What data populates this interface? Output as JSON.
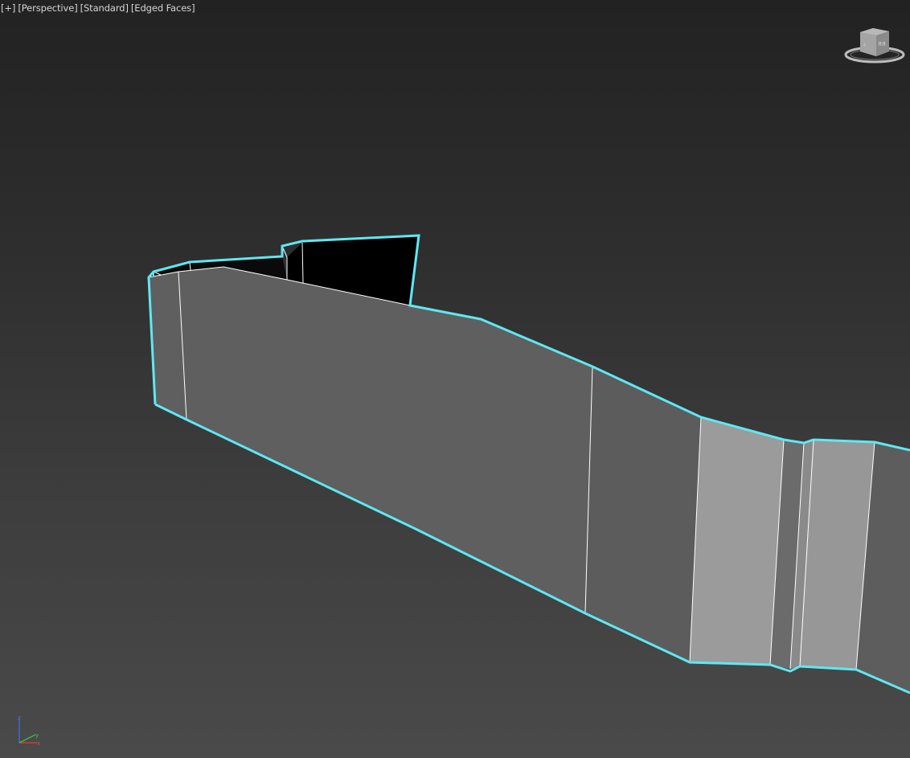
{
  "viewport": {
    "menu_plus": "[+]",
    "view_type": "[Perspective]",
    "shading_mode": "[Standard]",
    "display_mode": "[Edged Faces]"
  },
  "viewcube": {
    "icon": "viewcube-icon",
    "face_labels": [
      "TOP",
      "LEFT",
      "FRONT"
    ]
  },
  "axis_tripod": {
    "icon": "axis-tripod-icon",
    "axes": [
      "z",
      "y",
      "x"
    ]
  },
  "colors": {
    "background_top": "#222222",
    "background_bottom": "#4a4a4a",
    "selection_outline": "#5ee8f2",
    "face_dark": "#606060",
    "face_light": "#9a9a9a",
    "edge_white": "#ffffff"
  }
}
